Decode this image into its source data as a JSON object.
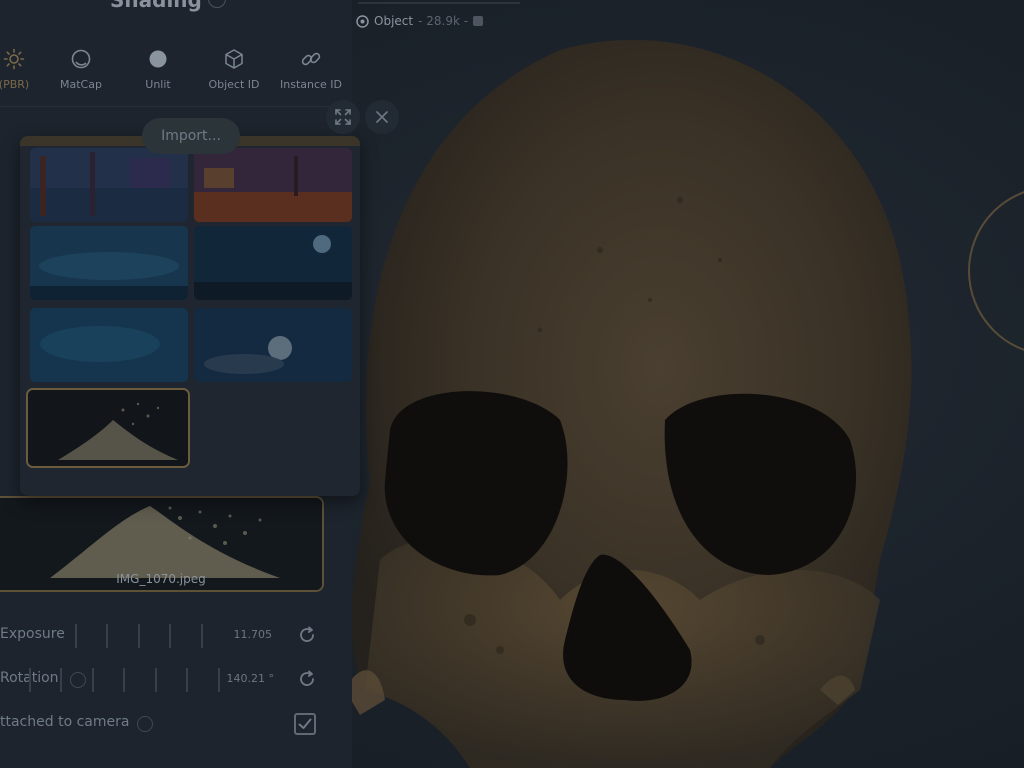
{
  "panel": {
    "title": "Shading"
  },
  "modes": [
    {
      "id": "pbr",
      "label": "(PBR)",
      "icon": "sun-icon",
      "active": true
    },
    {
      "id": "matcap",
      "label": "MatCap",
      "icon": "matcap-sphere-icon"
    },
    {
      "id": "unlit",
      "label": "Unlit",
      "icon": "filled-circle-icon"
    },
    {
      "id": "objectid",
      "label": "Object ID",
      "icon": "cube-icon"
    },
    {
      "id": "instanceid",
      "label": "Instance ID",
      "icon": "link-icon"
    }
  ],
  "environment": {
    "import_label": "Import...",
    "thumbnails": [
      {
        "name": "city-night"
      },
      {
        "name": "sunset-street"
      },
      {
        "name": "ocean-clouds"
      },
      {
        "name": "night-sky-moon"
      },
      {
        "name": "starry-sky"
      },
      {
        "name": "moon-clouds"
      },
      {
        "name": "campfire",
        "selected": true
      }
    ],
    "selected_file": "IMG_1070.jpeg"
  },
  "controls": {
    "exposure": {
      "label": "Exposure",
      "value": "11.705"
    },
    "rotation": {
      "label": "Rotation",
      "value": "140.21 °"
    },
    "attached": {
      "label": "ttached to camera",
      "checked": true
    }
  },
  "viewport": {
    "object_label": "Object",
    "object_sub": "- 28.9k -"
  },
  "colors": {
    "accent": "#6c5c3f",
    "panel_bg": "#1d242d",
    "viewport_bg": "#1b222b"
  }
}
